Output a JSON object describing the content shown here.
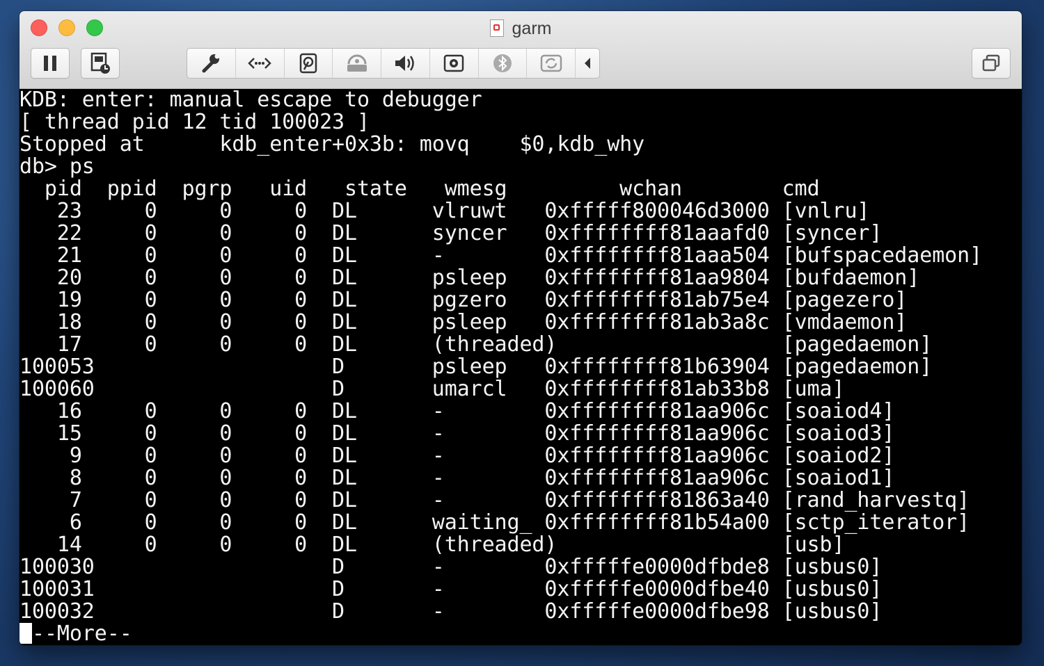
{
  "window": {
    "title": "garm"
  },
  "toolbar": {
    "left_buttons": [
      "pause-icon",
      "snapshot-icon"
    ],
    "segment_icons": [
      "wrench-icon",
      "network-icon",
      "hard-disk-icon",
      "shared-folder-icon",
      "volume-icon",
      "camera-icon",
      "bluetooth-icon",
      "usb-sharing-icon",
      "back-arrow-icon"
    ],
    "right_button": "windows-icon"
  },
  "terminal": {
    "lines": [
      "KDB: enter: manual escape to debugger",
      "[ thread pid 12 tid 100023 ]",
      "Stopped at      kdb_enter+0x3b: movq    $0,kdb_why",
      "db> ps",
      "  pid  ppid  pgrp   uid   state   wmesg         wchan        cmd",
      "   23     0     0     0  DL      vlruwt   0xfffff800046d3000 [vnlru]",
      "   22     0     0     0  DL      syncer   0xffffffff81aaafd0 [syncer]",
      "   21     0     0     0  DL      -        0xffffffff81aaa504 [bufspacedaemon]",
      "   20     0     0     0  DL      psleep   0xffffffff81aa9804 [bufdaemon]",
      "   19     0     0     0  DL      pgzero   0xffffffff81ab75e4 [pagezero]",
      "   18     0     0     0  DL      psleep   0xffffffff81ab3a8c [vmdaemon]",
      "   17     0     0     0  DL      (threaded)                  [pagedaemon]",
      "100053                   D       psleep   0xffffffff81b63904 [pagedaemon]",
      "100060                   D       umarcl   0xffffffff81ab33b8 [uma]",
      "   16     0     0     0  DL      -        0xffffffff81aa906c [soaiod4]",
      "   15     0     0     0  DL      -        0xffffffff81aa906c [soaiod3]",
      "    9     0     0     0  DL      -        0xffffffff81aa906c [soaiod2]",
      "    8     0     0     0  DL      -        0xffffffff81aa906c [soaiod1]",
      "    7     0     0     0  DL      -        0xffffffff81863a40 [rand_harvestq]",
      "    6     0     0     0  DL      waiting_ 0xffffffff81b54a00 [sctp_iterator]",
      "   14     0     0     0  DL      (threaded)                  [usb]",
      "100030                   D       -        0xfffffe0000dfbde8 [usbus0]",
      "100031                   D       -        0xfffffe0000dfbe40 [usbus0]",
      "100032                   D       -        0xfffffe0000dfbe98 [usbus0]"
    ],
    "prompt": "--More--"
  }
}
